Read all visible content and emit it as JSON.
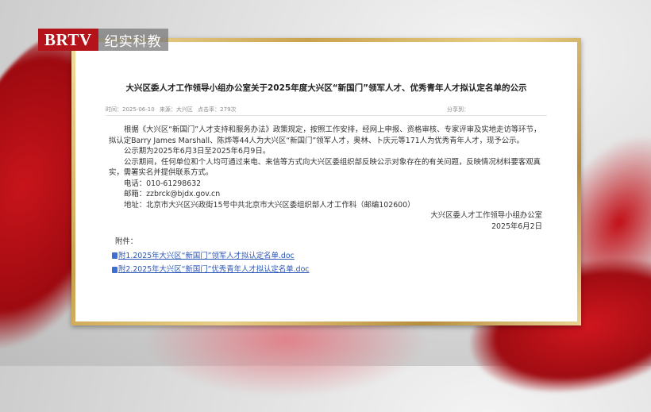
{
  "logo": {
    "brand": "BRTV",
    "channel": "纪实科教"
  },
  "notice": {
    "title": "大兴区委人才工作领导小组办公室关于2025年度大兴区“新国门”领军人才、优秀青年人才拟认定名单的公示",
    "meta": {
      "time_label": "时间：2025-06-10",
      "source_label": "来源：大兴区",
      "clicks_label": "点击率：279次",
      "share_label": "分享到："
    },
    "paragraph_1": "根据《大兴区“新国门”人才支持和服务办法》政策规定，按照工作安排，经网上申报、资格审核、专家评审及实地走访等环节，拟认定Barry James Marshall、陈烨等44人为大兴区“新国门”领军人才，奥林、卜庆元等171人为优秀青年人才，现予公示。",
    "paragraph_2": "公示期为2025年6月3日至2025年6月9日。",
    "paragraph_3": "公示期间，任何单位和个人均可通过来电、来信等方式向大兴区委组织部反映公示对象存在的有关问题，反映情况材料要客观真实，需署实名并提供联系方式。",
    "phone": "电话：010-61298632",
    "email": "邮箱：zzbrck@bjdx.gov.cn",
    "address": "地址：北京市大兴区兴政街15号中共北京市大兴区委组织部人才工作科（邮编102600）",
    "signature": "大兴区委人才工作领导小组办公室",
    "date": "2025年6月2日",
    "attachments_label": "附件：",
    "attachments": [
      {
        "label": "附1.2025年大兴区“新国门”领军人才拟认定名单.doc"
      },
      {
        "label": "附2.2025年大兴区“新国门”优秀青年人才拟认定名单.doc"
      }
    ]
  }
}
